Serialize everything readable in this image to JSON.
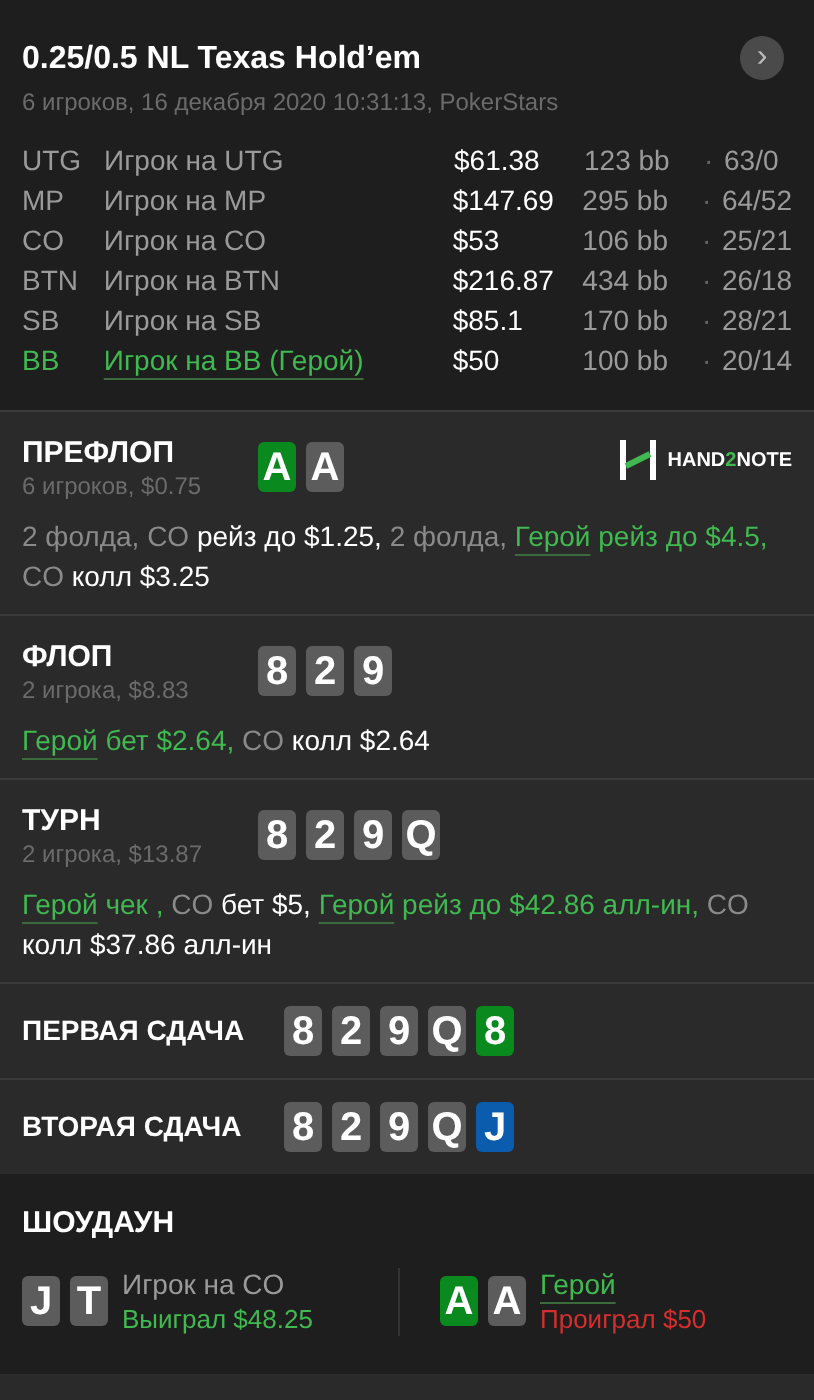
{
  "header": {
    "title": "0.25/0.5 NL Texas Hold’em",
    "subtitle": "6 игроков, 16 декабря 2020 10:31:13, PokerStars",
    "next_button": "›"
  },
  "players": [
    {
      "position": "UTG",
      "name": "Игрок на UTG",
      "stack": "$61.38",
      "bb": "123 bb",
      "stats": "63/0",
      "separator": "·",
      "hero": false
    },
    {
      "position": "MP",
      "name": "Игрок на MP",
      "stack": "$147.69",
      "bb": "295 bb",
      "stats": "64/52",
      "separator": "·",
      "hero": false
    },
    {
      "position": "CO",
      "name": "Игрок на CO",
      "stack": "$53",
      "bb": "106 bb",
      "stats": "25/21",
      "separator": "·",
      "hero": false
    },
    {
      "position": "BTN",
      "name": "Игрок на BTN",
      "stack": "$216.87",
      "bb": "434 bb",
      "stats": "26/18",
      "separator": "·",
      "hero": false
    },
    {
      "position": "SB",
      "name": "Игрок на SB",
      "stack": "$85.1",
      "bb": "170 bb",
      "stats": "28/21",
      "separator": "·",
      "hero": false
    },
    {
      "position": "BB",
      "name": "Игрок на BB (Герой)",
      "stack": "$50",
      "bb": "100 bb",
      "stats": "20/14",
      "separator": "·",
      "hero": true
    }
  ],
  "streets": [
    {
      "title": "ПРЕФЛОП",
      "info": "6 игроков, $0.75",
      "logo": [
        "HAND",
        "2",
        "NOTE"
      ],
      "cards": [
        {
          "rank": "A",
          "color": "#0a8a1e"
        },
        {
          "rank": "A",
          "color": "#5c5c5c"
        }
      ],
      "actions": [
        {
          "text": "2 фолда, CO",
          "kind": "muted"
        },
        {
          "text": "рейз до $1.25,",
          "kind": "strong"
        },
        {
          "text": "2 фолда,",
          "kind": "muted"
        },
        {
          "text": "Герой",
          "kind": "hero"
        },
        {
          "text": "рейз до $4.5,",
          "kind": "hero_action"
        },
        {
          "text": "CO",
          "kind": "muted"
        },
        {
          "text": "колл $3.25",
          "kind": "strong"
        }
      ]
    },
    {
      "title": "ФЛОП",
      "info": "2 игрока, $8.83",
      "cards": [
        {
          "rank": "8",
          "color": "#5c5c5c"
        },
        {
          "rank": "2",
          "color": "#5c5c5c"
        },
        {
          "rank": "9",
          "color": "#5c5c5c"
        }
      ],
      "actions": [
        {
          "text": "Герой",
          "kind": "hero"
        },
        {
          "text": "бет $2.64,",
          "kind": "hero_action"
        },
        {
          "text": "CO",
          "kind": "muted"
        },
        {
          "text": "колл $2.64",
          "kind": "strong"
        }
      ]
    },
    {
      "title": "ТУРН",
      "info": "2 игрока, $13.87",
      "cards": [
        {
          "rank": "8",
          "color": "#5c5c5c"
        },
        {
          "rank": "2",
          "color": "#5c5c5c"
        },
        {
          "rank": "9",
          "color": "#5c5c5c"
        },
        {
          "rank": "Q",
          "color": "#5c5c5c"
        }
      ],
      "actions": [
        {
          "text": "Герой",
          "kind": "hero"
        },
        {
          "text": "чек ,",
          "kind": "hero_action"
        },
        {
          "text": "CO",
          "kind": "muted"
        },
        {
          "text": "бет $5,",
          "kind": "strong"
        },
        {
          "text": "Герой",
          "kind": "hero"
        },
        {
          "text": "рейз до $42.86 алл-ин,",
          "kind": "hero_action"
        },
        {
          "text": "CO",
          "kind": "muted"
        },
        {
          "text": "колл $37.86 алл-ин",
          "kind": "strong"
        }
      ]
    }
  ],
  "runouts": [
    {
      "title": "ПЕРВАЯ СДАЧА",
      "cards": [
        {
          "rank": "8",
          "color": "#5c5c5c"
        },
        {
          "rank": "2",
          "color": "#5c5c5c"
        },
        {
          "rank": "9",
          "color": "#5c5c5c"
        },
        {
          "rank": "Q",
          "color": "#5c5c5c"
        },
        {
          "rank": "8",
          "color": "#0a8a1e"
        }
      ]
    },
    {
      "title": "ВТОРАЯ СДАЧА",
      "cards": [
        {
          "rank": "8",
          "color": "#5c5c5c"
        },
        {
          "rank": "2",
          "color": "#5c5c5c"
        },
        {
          "rank": "9",
          "color": "#5c5c5c"
        },
        {
          "rank": "Q",
          "color": "#5c5c5c"
        },
        {
          "rank": "J",
          "color": "#0b5cad"
        }
      ]
    }
  ],
  "showdown": {
    "title": "ШОУДАУН",
    "hands": [
      {
        "player": "Игрок на CO",
        "hero": false,
        "result": "Выиграл $48.25",
        "won": true,
        "cards": [
          {
            "rank": "J",
            "color": "#5c5c5c"
          },
          {
            "rank": "T",
            "color": "#5c5c5c"
          }
        ]
      },
      {
        "player": "Герой",
        "hero": true,
        "result": "Проиграл $50",
        "won": false,
        "cards": [
          {
            "rank": "A",
            "color": "#0a8a1e"
          },
          {
            "rank": "A",
            "color": "#5c5c5c"
          }
        ]
      }
    ]
  }
}
